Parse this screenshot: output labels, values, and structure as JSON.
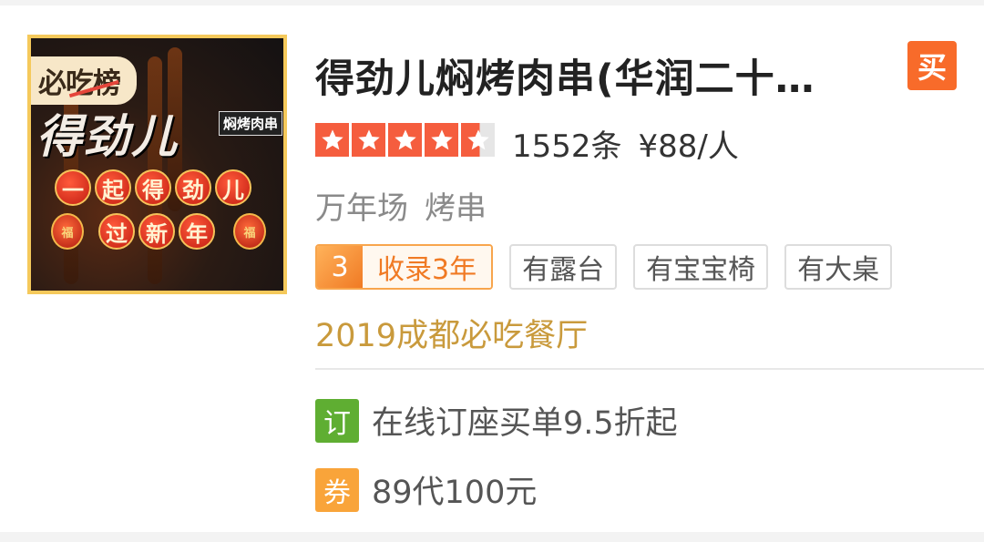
{
  "thumbnail": {
    "badge": "必吃榜",
    "brand": "得劲儿",
    "brand_tag": "焖烤肉串",
    "row1": [
      "一",
      "起",
      "得",
      "劲",
      "儿"
    ],
    "row2": [
      "过",
      "新",
      "年"
    ],
    "lantern": "福"
  },
  "shop": {
    "title": "得劲儿焖烤肉串(华润二十…",
    "buy_badge": "买",
    "rating_stars": 4.5,
    "review_count": "1552条",
    "price": "¥88/人",
    "district": "万年场",
    "category": "烤串"
  },
  "tags": {
    "rank_number": "3",
    "rank_text": "收录3年",
    "features": [
      "有露台",
      "有宝宝椅",
      "有大桌"
    ]
  },
  "award": "2019成都必吃餐厅",
  "deals": [
    {
      "icon_label": "订",
      "icon_color": "#5fae32",
      "text": "在线订座买单9.5折起"
    },
    {
      "icon_label": "券",
      "icon_color": "#f9a43a",
      "text": "89代100元"
    }
  ],
  "colors": {
    "star": "#f55d3e",
    "buy": "#f86b2a",
    "award": "#c99a3c",
    "rank": "#f07a24"
  }
}
